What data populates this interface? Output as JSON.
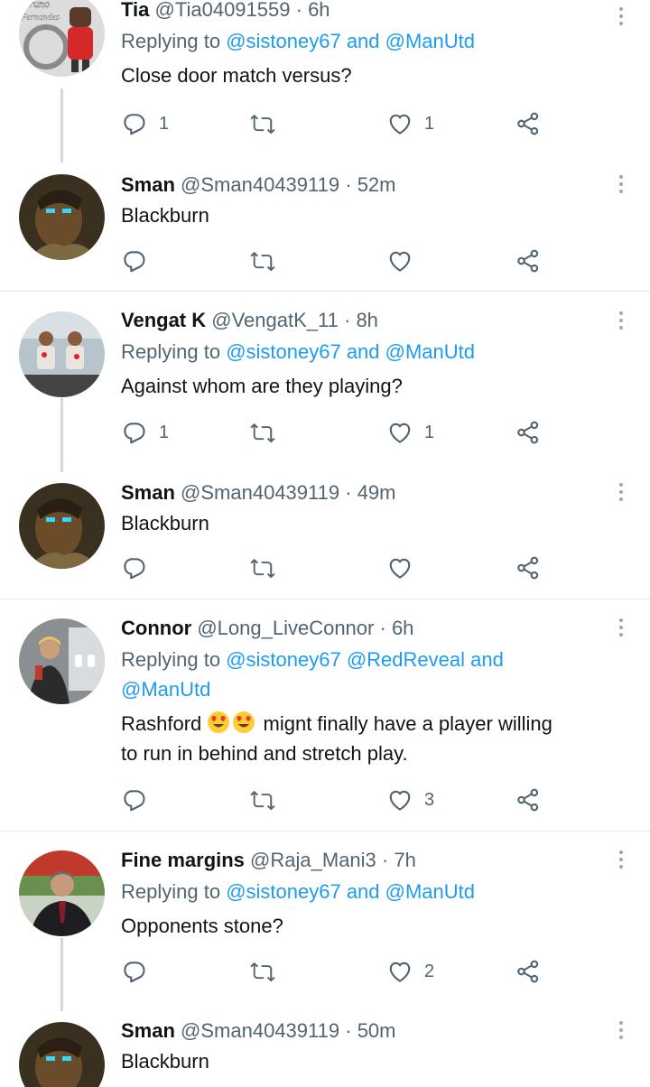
{
  "colors": {
    "accent": "#1d9bf0",
    "muted": "#536471",
    "text": "#0f1419",
    "divider": "#e6e9ec"
  },
  "tweets": [
    {
      "name": "Tia",
      "handle": "@Tia04091559",
      "dot": "·",
      "time": "6h",
      "reply_prefix": "Replying to ",
      "reply_links": [
        "@sistoney67",
        "@ManUtd"
      ],
      "reply_join": " and ",
      "text": "Close door match versus?",
      "reply_count": "1",
      "like_count": "1",
      "avatar_text": "Bruno Fernandes"
    },
    {
      "name": "Sman",
      "handle": "@Sman40439119",
      "dot": "·",
      "time": "52m",
      "text": "Blackburn",
      "reply_count": "",
      "like_count": ""
    },
    {
      "name": "Vengat K",
      "handle": "@VengatK_11",
      "dot": "·",
      "time": "8h",
      "reply_prefix": "Replying to ",
      "reply_links": [
        "@sistoney67",
        "@ManUtd"
      ],
      "reply_join": " and ",
      "text": "Against whom are they playing?",
      "reply_count": "1",
      "like_count": "1"
    },
    {
      "name": "Sman",
      "handle": "@Sman40439119",
      "dot": "·",
      "time": "49m",
      "text": "Blackburn",
      "reply_count": "",
      "like_count": ""
    },
    {
      "name": "Connor",
      "handle": "@Long_LiveConnor",
      "dot": "·",
      "time": "6h",
      "reply_prefix": "Replying to ",
      "reply_links": [
        "@sistoney67",
        "@RedReveal",
        "@ManUtd"
      ],
      "reply_join": " and ",
      "text_before_emoji": "Rashford ",
      "text_after_emoji": " mignt finally have a player willing",
      "text_line2": "to run in behind and stretch play.",
      "reply_count": "",
      "like_count": "3"
    },
    {
      "name": "Fine margins",
      "handle": "@Raja_Mani3",
      "dot": "·",
      "time": "7h",
      "reply_prefix": "Replying to ",
      "reply_links": [
        "@sistoney67",
        "@ManUtd"
      ],
      "reply_join": " and ",
      "text": "Opponents stone?",
      "reply_count": "",
      "like_count": "2"
    },
    {
      "name": "Sman",
      "handle": "@Sman40439119",
      "dot": "·",
      "time": "50m",
      "text": "Blackburn"
    }
  ],
  "icons": {
    "reply": "reply-icon",
    "retweet": "retweet-icon",
    "like": "heart-icon",
    "share": "share-icon",
    "more": "more-vertical-icon",
    "emoji": "heart-eyes-emoji"
  }
}
